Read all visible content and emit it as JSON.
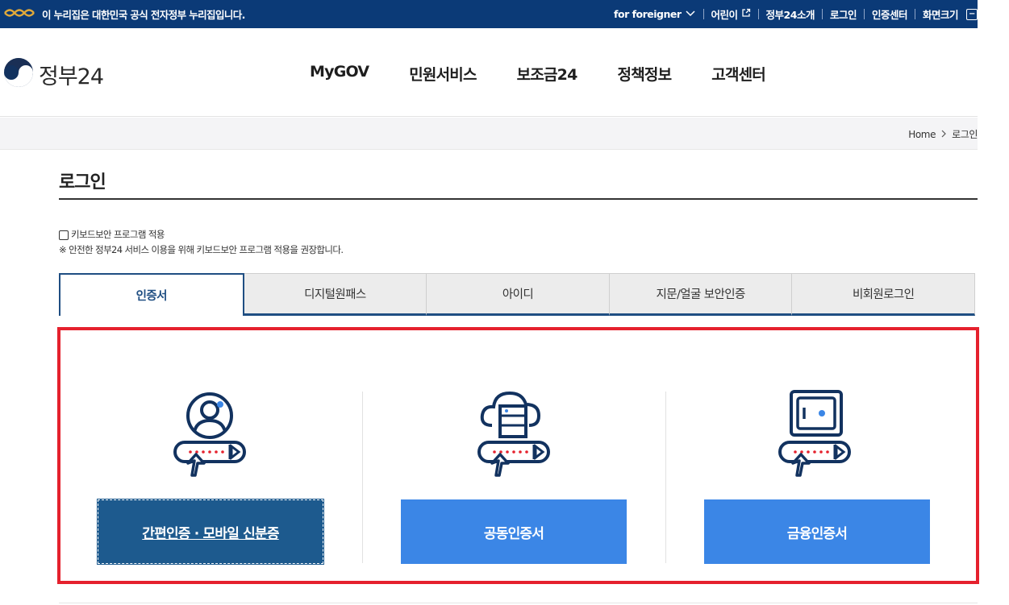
{
  "notice": {
    "text": "이 누리집은 대한민국 공식 전자정부 누리집입니다.",
    "icon": "gov-emblem-icon"
  },
  "util": {
    "foreigner": "for foreigner",
    "kids": "어린이",
    "about": "정부24소개",
    "login": "로그인",
    "cert_center": "인증센터",
    "screen_size": "화면크기",
    "screen_btn": "−"
  },
  "logo": {
    "name": "정부24"
  },
  "gnb": [
    "MyGOV",
    "민원서비스",
    "보조금24",
    "정책정보",
    "고객센터"
  ],
  "breadcrumb": {
    "home": "Home",
    "current": "로그인"
  },
  "page": {
    "title": "로그인"
  },
  "keyboard": {
    "label": "키보드보안 프로그램 적용",
    "notice": "※ 안전한 정부24 서비스 이용을 위해 키보드보안 프로그램 적용을 권장합니다."
  },
  "tabs": [
    "인증서",
    "디지털원패스",
    "아이디",
    "지문/얼굴 보안인증",
    "비회원로그인"
  ],
  "certs": {
    "simple": "간편인증 · 모바일 신분증",
    "joint": "공동인증서",
    "financial": "금융인증서"
  },
  "colors": {
    "navy": "#0b3a77",
    "active": "#1f4e82",
    "button": "#3b86e6",
    "button_dark": "#1d5a8e",
    "highlight": "#e5212d",
    "dots": "#e5212d"
  }
}
